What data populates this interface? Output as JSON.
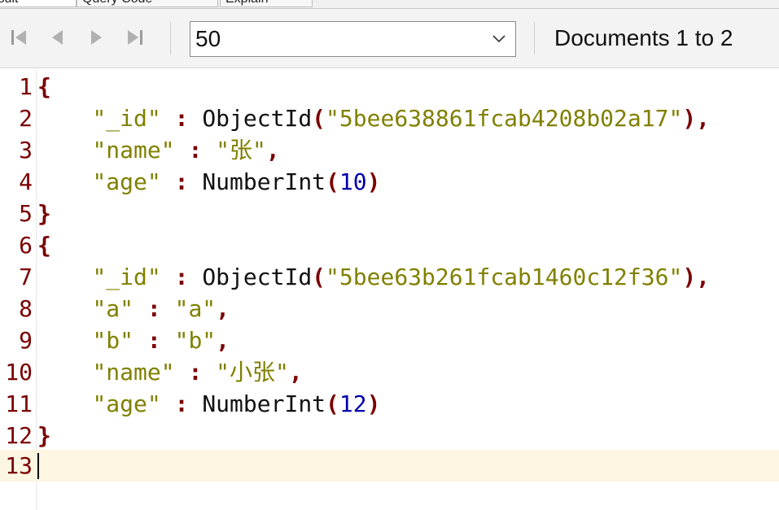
{
  "tabs": [
    {
      "label": "Result"
    },
    {
      "label": "Query Code"
    },
    {
      "label": "Explain"
    }
  ],
  "toolbar": {
    "page_size": "50",
    "documents_label": "Documents 1 to 2",
    "icons": [
      "first-page-icon",
      "previous-page-icon",
      "next-page-icon",
      "last-page-icon",
      "chevron-down-icon"
    ]
  },
  "editor": {
    "lines": [
      {
        "n": "1"
      },
      {
        "n": "2"
      },
      {
        "n": "3"
      },
      {
        "n": "4"
      },
      {
        "n": "5"
      },
      {
        "n": "6"
      },
      {
        "n": "7"
      },
      {
        "n": "8"
      },
      {
        "n": "9"
      },
      {
        "n": "10"
      },
      {
        "n": "11"
      },
      {
        "n": "12"
      },
      {
        "n": "13"
      }
    ],
    "doc1": {
      "id_key": "\"_id\"",
      "id_func": "ObjectId",
      "id_val": "\"5bee638861fcab4208b02a17\"",
      "name_key": "\"name\"",
      "name_val": "\"张\"",
      "age_key": "\"age\"",
      "age_func": "NumberInt",
      "age_val": "10"
    },
    "doc2": {
      "id_key": "\"_id\"",
      "id_func": "ObjectId",
      "id_val": "\"5bee63b261fcab1460c12f36\"",
      "a_key": "\"a\"",
      "a_val": "\"a\"",
      "b_key": "\"b\"",
      "b_val": "\"b\"",
      "name_key": "\"name\"",
      "name_val": "\"小张\"",
      "age_key": "\"age\"",
      "age_func": "NumberInt",
      "age_val": "12"
    },
    "colors": {
      "line_number": "#7a0000",
      "key": "#808000",
      "number": "#0000aa",
      "current_line": "#fdf6e3"
    }
  }
}
